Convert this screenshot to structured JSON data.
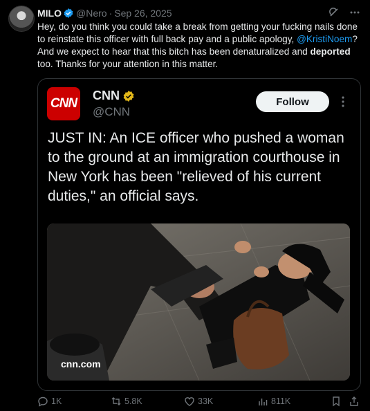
{
  "tweet": {
    "author_name": "MILO",
    "author_handle": "@Nero",
    "separator": "·",
    "date": "Sep 26, 2025",
    "text_1": "Hey, do you think you could take a break from getting your fucking nails done to reinstate this officer with full back pay and a public apology, ",
    "mention": "@KristiNoem",
    "text_2": "? And we expect to hear that this bitch has been denaturalized and ",
    "bold_word": "deported",
    "text_3": " too. Thanks for your attention in this matter."
  },
  "quoted": {
    "logo_text": "CNN",
    "name": "CNN",
    "handle": "@CNN",
    "follow_label": "Follow",
    "text": "JUST IN: An ICE officer who pushed a woman to the ground at an immigration courthouse in New York has been \"relieved of his current duties,\" an official says.",
    "link_caption": "cnn.com"
  },
  "actions": {
    "replies": "1K",
    "reposts": "5.8K",
    "likes": "33K",
    "views": "811K"
  },
  "colors": {
    "accent": "#1d9bf0",
    "cnn_red": "#cc0000",
    "gold_badge": "#e2b719"
  }
}
